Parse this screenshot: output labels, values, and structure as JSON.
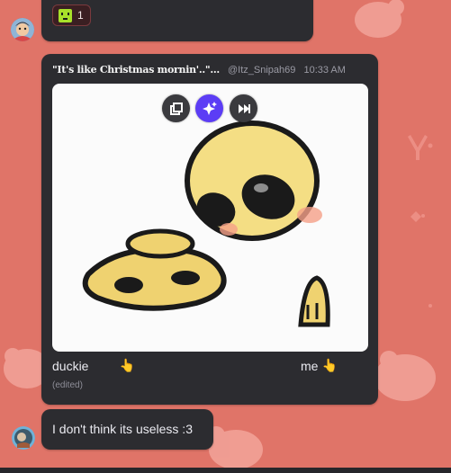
{
  "theme": {
    "background": "#e07468",
    "bubble": "#2c2c30",
    "accent": "#5c3df5"
  },
  "reaction": {
    "emoji": "green-square-face-emoji",
    "count": "1"
  },
  "reply": {
    "title": "\"It's like Christmas mornin'..\"...",
    "author": "@Itz_Snipah69",
    "time": "10:33 AM"
  },
  "media": {
    "buttons": [
      "open-external-icon",
      "sparkle-icon",
      "skip-forward-icon"
    ]
  },
  "message1": {
    "caption_left": "duckie",
    "caption_right": "me",
    "pointing_emoji": "👆",
    "edited_label": "(edited)"
  },
  "message2": {
    "text": "I don't think its useless :3"
  }
}
